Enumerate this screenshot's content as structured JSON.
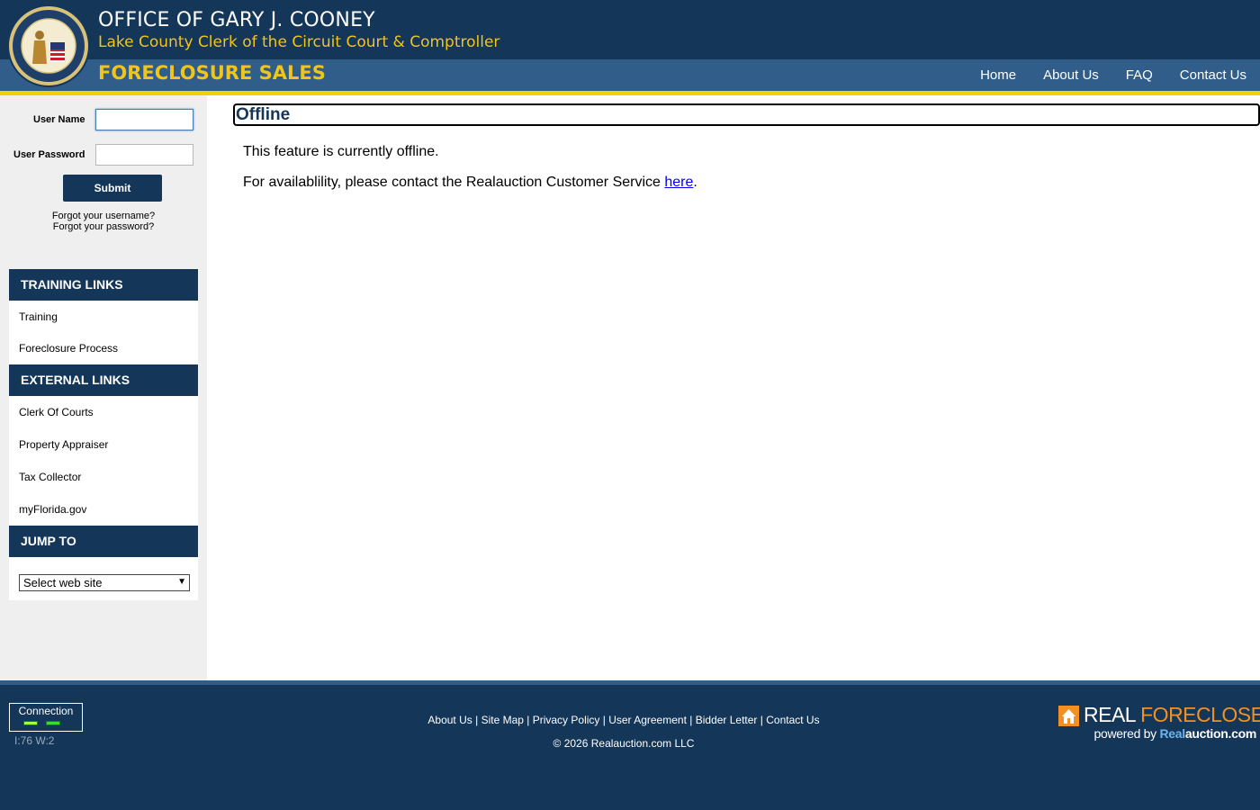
{
  "header": {
    "office_title": "OFFICE OF GARY J. COONEY",
    "office_subtitle": "Lake County Clerk of the Circuit Court & Comptroller",
    "site_name": "FORECLOSURE SALES",
    "nav": [
      {
        "label": "Home"
      },
      {
        "label": "About Us"
      },
      {
        "label": "FAQ"
      },
      {
        "label": "Contact Us"
      }
    ],
    "colors": {
      "navy": "#143659",
      "band": "#305d8a",
      "gold": "#f0c419",
      "accent_bar": "#f5d000"
    }
  },
  "login": {
    "username_label": "User Name",
    "username_value": "",
    "password_label": "User Password",
    "password_value": "",
    "submit_label": "Submit",
    "forgot_username": "Forgot your username?",
    "forgot_password": "Forgot your password?"
  },
  "sidebar": {
    "training_heading": "TRAINING LINKS",
    "training_links": [
      {
        "label": "Training"
      },
      {
        "label": "Foreclosure Process"
      }
    ],
    "external_heading": "EXTERNAL LINKS",
    "external_links": [
      {
        "label": "Clerk Of Courts"
      },
      {
        "label": "Property Appraiser"
      },
      {
        "label": "Tax Collector"
      },
      {
        "label": "myFlorida.gov"
      }
    ],
    "jump_heading": "JUMP TO",
    "jump_selected": "Select web site"
  },
  "main": {
    "title": "Offline",
    "message_1": "This feature is currently offline.",
    "message_2_prefix": "For availablility, please contact the Realauction Customer Service ",
    "message_2_link": "here",
    "message_2_suffix": "."
  },
  "footer": {
    "connection_label": "Connection",
    "connection_stats": "I:76 W:2",
    "links": [
      {
        "label": "About Us"
      },
      {
        "label": "Site Map"
      },
      {
        "label": "Privacy Policy"
      },
      {
        "label": "User Agreement"
      },
      {
        "label": "Bidder Letter"
      },
      {
        "label": "Contact Us"
      }
    ],
    "copyright": "© 2026 Realauction.com LLC",
    "logo_word1": "REAL",
    "logo_word2": "FORECLOSE",
    "powered_by": "powered by",
    "powered_real": "Real",
    "powered_auction": "auction.com"
  }
}
